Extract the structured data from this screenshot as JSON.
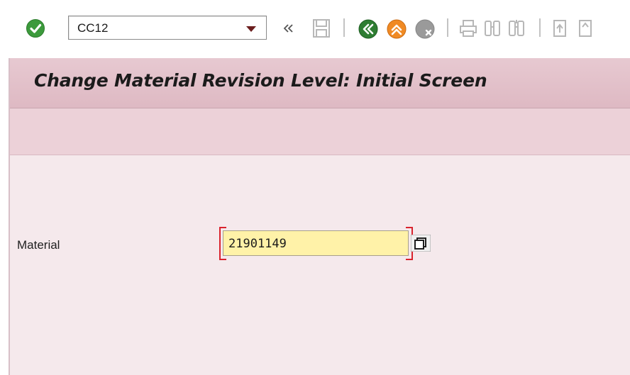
{
  "toolbar": {
    "command_field_value": "CC12",
    "icons": [
      "enter-icon",
      "command-field-dropdown-icon",
      "collapse-double-chevron-icon",
      "save-icon",
      "back-icon",
      "exit-icon",
      "cancel-icon",
      "print-icon",
      "find-icon",
      "find-next-icon",
      "first-page-icon",
      "previous-page-icon"
    ],
    "colors": {
      "enter_green": "#3c9a3c",
      "back_green": "#2e7d32",
      "exit_orange": "#f08a24",
      "cancel_gray": "#9a9a9a"
    }
  },
  "window": {
    "title": "Change Material Revision Level: Initial Screen",
    "colors": {
      "title_bar": "#e2c1ca",
      "app_toolbar": "#ecd1d8",
      "content": "#f5e9ec",
      "required_marker": "#d9232d",
      "input_background": "#fff2a8"
    }
  },
  "form": {
    "material_label": "Material",
    "material_value": "21901149",
    "material_required": true,
    "value_help_icon": "value-help-icon"
  }
}
